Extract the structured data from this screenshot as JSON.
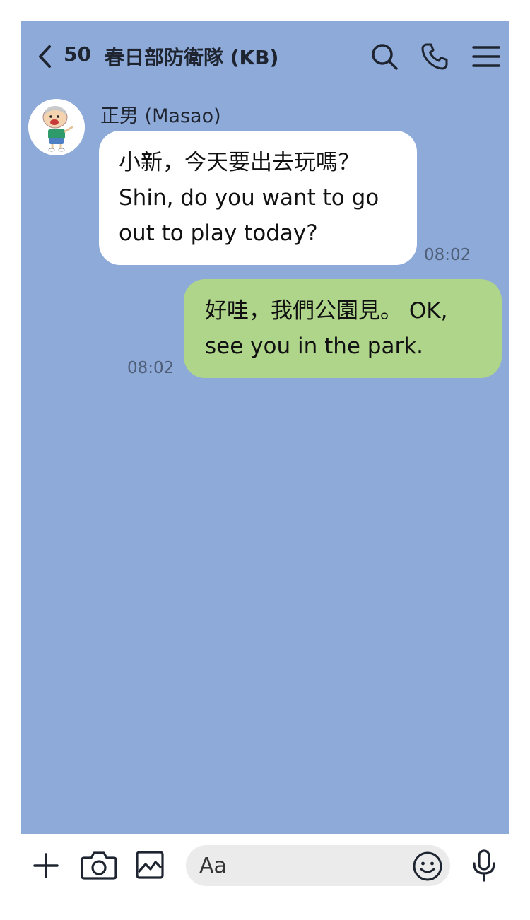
{
  "header": {
    "unread_count": "50",
    "title": "春日部防衛隊 (KB)",
    "icons": [
      "chevron-left-icon",
      "search-icon",
      "phone-icon",
      "menu-icon"
    ]
  },
  "messages": [
    {
      "direction": "incoming",
      "sender": "正男 (Masao)",
      "lines": [
        "小新，今天要出去玩嗎？",
        "Shin, do you want to go",
        "out to play today?"
      ],
      "time": "08:02"
    },
    {
      "direction": "outgoing",
      "lines": [
        "好哇，我們公園見。 OK,",
        "see you in the park."
      ],
      "time": "08:02"
    }
  ],
  "input_bar": {
    "placeholder": "Aa",
    "icons": [
      "plus-icon",
      "camera-icon",
      "image-icon",
      "emoji-icon",
      "microphone-icon"
    ]
  },
  "colors": {
    "chat_background": "#8eaad9",
    "incoming_bubble": "#ffffff",
    "outgoing_bubble": "#afd58b",
    "input_field": "#ebebeb"
  }
}
